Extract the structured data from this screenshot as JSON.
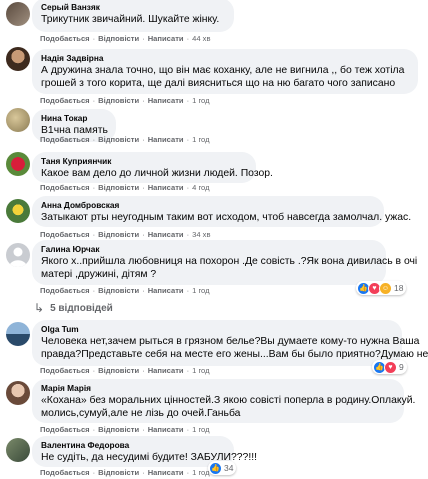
{
  "action_labels": {
    "like": "Подобається",
    "reply": "Відповісти",
    "message": "Написати"
  },
  "comments": [
    {
      "author": "Серый Ванзяк",
      "lines": [
        "Трикутник звичайний. Шукайте жінку."
      ],
      "time": "44 хв"
    },
    {
      "author": "Надія Задвірна",
      "lines": [
        "А дружина знала точно, що він має коханку, але не вигнила ,, бо теж хотіла",
        "грошей з того корита, ще далі виясниться що на ню багато чого записано"
      ],
      "time": "1 год"
    },
    {
      "author": "Нина Токар",
      "lines": [
        "В1чна память"
      ],
      "time": "1 год"
    },
    {
      "author": "Таня Куприянчик",
      "lines": [
        "Какое вам дело до личной жизни людей. Позор."
      ],
      "time": "4 год"
    },
    {
      "author": "Анна Домбровская",
      "lines": [
        "Затыкают рты неугодным таким вот исходом, чтоб навсегда замолчал. ужас."
      ],
      "time": "34 хв"
    },
    {
      "author": "Галина Юрчак",
      "lines": [
        "Якого х..прийшла любовниця на похорон .Де совість .?Як вона дивилась в очі",
        "матері ,дружині, дітям ?"
      ],
      "time": "1 год",
      "reactions": "18"
    },
    {
      "author": "Olga Tum",
      "lines": [
        "Человека нет,зачем рыться в грязном белье?Вы думаете кому-то нужна Ваша",
        "правда?Представьте себя на месте его жены...Вам бы было приятно?Думаю нет!"
      ],
      "time": "1 год",
      "reactions": "9"
    },
    {
      "author": "Марія Марія",
      "lines": [
        "«Кохана» без моральних цінностей.З якою совісті поперла в родину.Оплакуй.",
        "молись,сумуй,але не лізь до очей.Ганьба"
      ],
      "time": "1 год"
    },
    {
      "author": "Валентина Федорова",
      "lines": [
        "Не судіть, да несудимі будите! ЗАБУЛИ???!!!"
      ],
      "time": "1 год",
      "reactions": "34"
    }
  ],
  "replies_link": "5 відповідей",
  "colors": {
    "bubble": "#f0f2f5",
    "secondary_text": "#65676b",
    "like_blue": "#1877f2",
    "love_red": "#f33e58",
    "haha_yellow": "#f7b125"
  }
}
